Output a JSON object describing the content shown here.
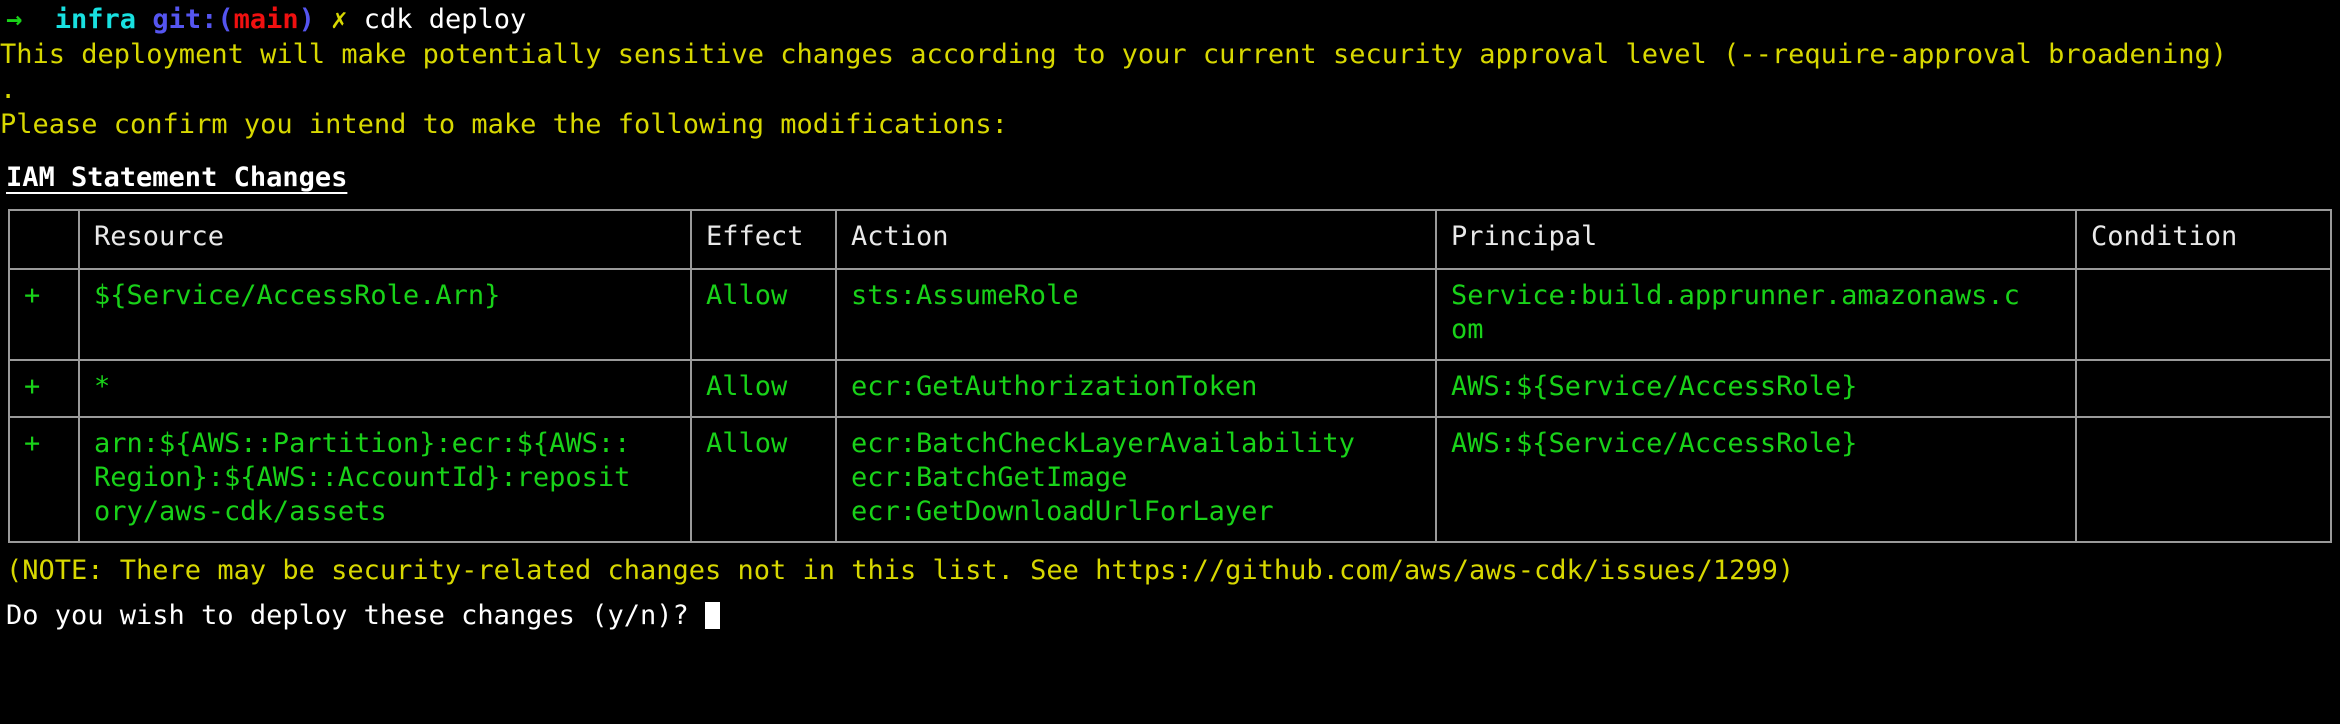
{
  "prompt": {
    "arrow": "→",
    "directory": "infra",
    "git_prefix": "git:(",
    "git_branch": "main",
    "git_suffix": ")",
    "status_mark": "✗",
    "command": "cdk deploy"
  },
  "warning": {
    "line1": "This deployment will make potentially sensitive changes according to your current security approval level (--require-approval broadening)",
    "line2": ".",
    "line3": "Please confirm you intend to make the following modifications:"
  },
  "section": {
    "title": "IAM Statement Changes"
  },
  "table": {
    "headers": [
      "",
      "Resource",
      "Effect",
      "Action",
      "Principal",
      "Condition"
    ],
    "rows": [
      {
        "mark": "+",
        "resource": [
          "${Service/AccessRole.Arn}"
        ],
        "effect": "Allow",
        "action": [
          "sts:AssumeRole"
        ],
        "principal": [
          "Service:build.apprunner.amazonaws.c",
          "om"
        ],
        "condition": ""
      },
      {
        "mark": "+",
        "resource": [
          "*"
        ],
        "effect": "Allow",
        "action": [
          "ecr:GetAuthorizationToken"
        ],
        "principal": [
          "AWS:${Service/AccessRole}"
        ],
        "condition": ""
      },
      {
        "mark": "+",
        "resource": [
          "arn:${AWS::Partition}:ecr:${AWS::",
          "Region}:${AWS::AccountId}:reposit",
          "ory/aws-cdk/assets"
        ],
        "effect": "Allow",
        "action": [
          "ecr:BatchCheckLayerAvailability",
          "ecr:BatchGetImage",
          "ecr:GetDownloadUrlForLayer"
        ],
        "principal": [
          "AWS:${Service/AccessRole}"
        ],
        "condition": ""
      }
    ]
  },
  "note": "(NOTE: There may be security-related changes not in this list. See https://github.com/aws/aws-cdk/issues/1299)",
  "confirm": {
    "question": "Do you wish to deploy these changes (y/n)? "
  },
  "colors": {
    "background": "#000000",
    "added": "#19d219",
    "warning": "#d8d800",
    "prompt_arrow": "#19d219",
    "prompt_dir": "#18e0e0",
    "prompt_git": "#5555f0",
    "prompt_branch": "#f01010",
    "prompt_mark": "#d8d800",
    "text": "#ffffff",
    "border": "#9a9a9a"
  }
}
